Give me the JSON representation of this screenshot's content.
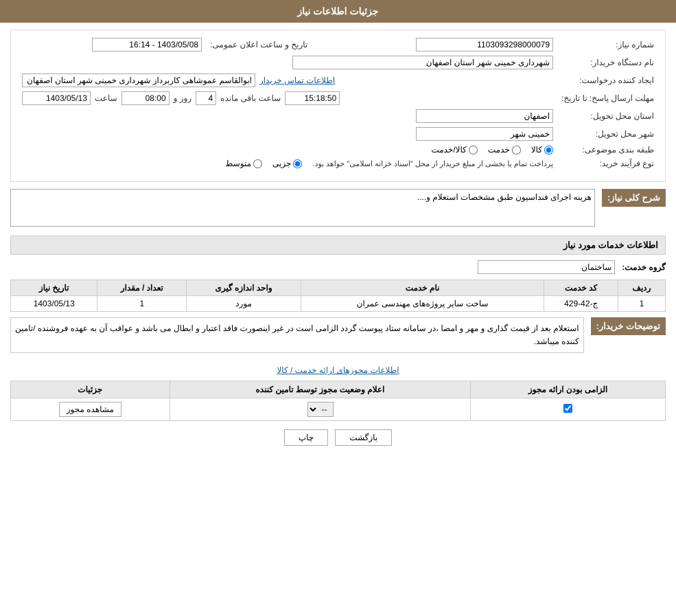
{
  "page": {
    "title": "جزئیات اطلاعات نیاز"
  },
  "header": {
    "title": "جزئیات اطلاعات نیاز"
  },
  "fields": {
    "need_number_label": "شماره نیاز:",
    "need_number_value": "1103093298000079",
    "date_label": "تاریخ و ساعت اعلان عمومی:",
    "date_value": "1403/05/08 - 16:14",
    "buyer_name_label": "نام دستگاه خریدار:",
    "buyer_name_value": "شهرداری خمینی شهر استان اصفهان",
    "creator_label": "ایجاد کننده درخواست:",
    "creator_value": "ابوالقاسم عموشاهی کاربرداز شهرداری خمینی شهر استان اصفهان",
    "contact_link": "اطلاعات تماس خریدار",
    "deadline_label": "مهلت ارسال پاسخ: تا تاریخ:",
    "deadline_date": "1403/05/13",
    "deadline_time_label": "ساعت",
    "deadline_time": "08:00",
    "deadline_days_label": "روز و",
    "deadline_days": "4",
    "deadline_remaining_label": "ساعت باقی مانده",
    "deadline_remaining": "15:18:50",
    "province_label": "استان محل تحویل:",
    "province_value": "اصفهان",
    "city_label": "شهر محل تحویل:",
    "city_value": "خمینی شهر",
    "category_label": "طبقه بندی موضوعی:",
    "category_options": [
      "کالا",
      "خدمت",
      "کالا/خدمت"
    ],
    "category_selected": "کالا",
    "purchase_type_label": "نوع فرآیند خرید:",
    "purchase_type_note": "پرداخت تمام یا بخشی از مبلغ خریدار از محل \"اسناد خزانه اسلامی\" خواهد بود.",
    "purchase_type_options": [
      "جزیی",
      "متوسط"
    ],
    "purchase_type_selected": "جزیی",
    "need_description_label": "شرح کلی نیاز:",
    "need_description_value": "هزینه اجرای فنداسیون طبق مشخصات استعلام و....",
    "services_header": "اطلاعات خدمات مورد نیاز",
    "service_group_label": "گروه خدمت:",
    "service_group_value": "ساختمان",
    "table_headers": {
      "row_num": "ردیف",
      "service_code": "کد خدمت",
      "service_name": "نام خدمت",
      "unit": "واحد اندازه گیری",
      "quantity": "تعداد / مقدار",
      "need_date": "تاریخ نیاز"
    },
    "table_rows": [
      {
        "row_num": "1",
        "service_code": "ج-42-429",
        "service_name": "ساخت سایر پروژه‌های مهندسی عمران",
        "unit": "مورد",
        "quantity": "1",
        "need_date": "1403/05/13"
      }
    ],
    "buyer_notes_label": "توضیحات خریدار:",
    "buyer_notes_value": "استعلام بعد از قیمت گذاری و مهر و امضا ،در سامانه ستاد پیوست گردد الزامی است در غیر اینصورت فاقد اعتبار و ابطال می باشد و عواقب آن به عهده فروشنده /تامین کننده میباشد.",
    "permissions_link": "اطلاعات مجوزهای ارائه خدمت / کالا",
    "permissions_table": {
      "headers": {
        "col1": "الزامی بودن ارائه مجوز",
        "col2": "اعلام وضعیت مجوز توسط تامین کننده",
        "col3": "جزئیات"
      },
      "rows": [
        {
          "required": true,
          "status": "--",
          "details_btn": "مشاهده مجوز"
        }
      ]
    },
    "btn_print": "چاپ",
    "btn_back": "بازگشت"
  }
}
